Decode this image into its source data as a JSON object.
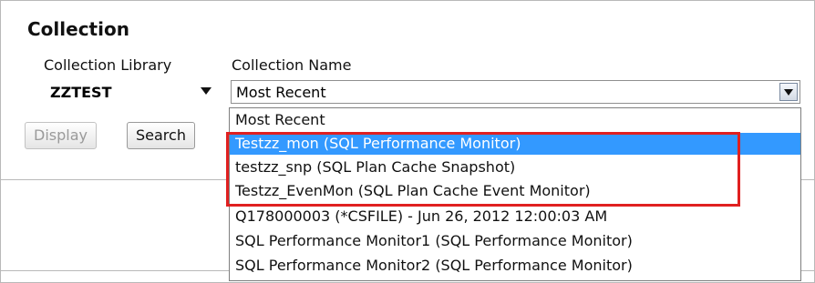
{
  "section": {
    "title": "Collection"
  },
  "fields": {
    "library_label": "Collection Library",
    "name_label": "Collection Name"
  },
  "library_select": {
    "value": "ZZTEST"
  },
  "name_select": {
    "value": "Most Recent"
  },
  "buttons": {
    "display": "Display",
    "search": "Search"
  },
  "dropdown": {
    "options": [
      "Most Recent",
      "Testzz_mon (SQL Performance Monitor)",
      "testzz_snp (SQL Plan Cache Snapshot)",
      "Testzz_EvenMon (SQL Plan Cache Event Monitor)",
      "Q178000003 (*CSFILE) - Jun 26, 2012 12:00:03 AM",
      "SQL Performance Monitor1 (SQL Performance Monitor)",
      "SQL Performance Monitor2 (SQL Performance Monitor)"
    ],
    "selected_index": 1
  },
  "colors": {
    "selection": "#3399ff",
    "highlight_border": "#e02020"
  }
}
